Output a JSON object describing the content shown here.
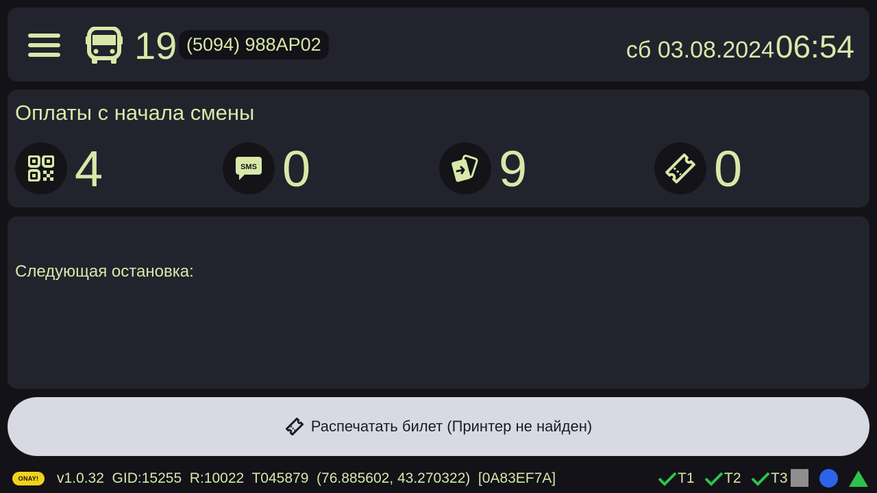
{
  "header": {
    "route_number": "19",
    "vehicle_plate": "(5094) 988AP02",
    "date": "сб 03.08.2024",
    "time": "06:54"
  },
  "payments": {
    "title": "Оплаты с начала смены",
    "items": [
      {
        "icon": "qr-code-icon",
        "count": "4"
      },
      {
        "icon": "sms-icon",
        "count": "0"
      },
      {
        "icon": "card-payment-icon",
        "count": "9"
      },
      {
        "icon": "ticket-icon",
        "count": "0"
      }
    ]
  },
  "next_stop": {
    "label": "Следующая остановка:"
  },
  "print_button": {
    "label": "Распечатать билет (Принтер не найден)"
  },
  "status_bar": {
    "logo": "ONAY!",
    "info": "v1.0.32  GID:15255  R:10022  T045879  (76.885602, 43.270322)  [0A83EF7A]",
    "terminals": [
      "T1",
      "T2",
      "T3"
    ]
  },
  "colors": {
    "accent": "#d8e8a8",
    "panel": "#23232d",
    "background": "#121218",
    "button": "#d8d9e2",
    "check": "#2ec24a",
    "blue_indicator": "#2d63ea",
    "green_indicator": "#2ec24a",
    "gray_indicator": "#8e8e8e"
  }
}
